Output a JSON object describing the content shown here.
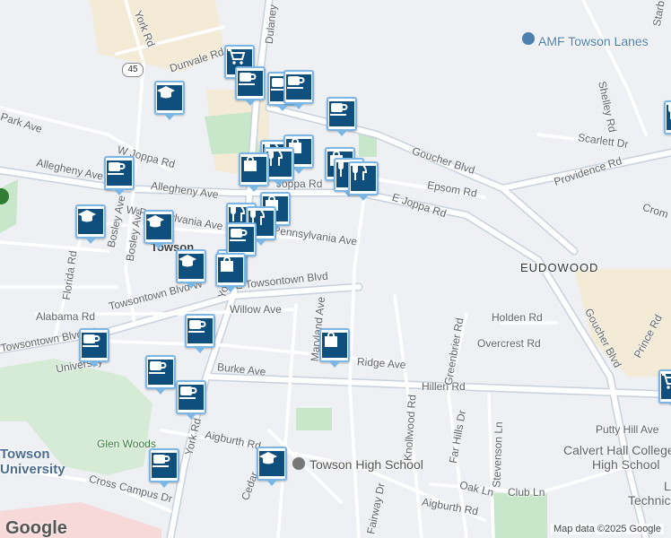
{
  "map": {
    "colors": {
      "background": "#eef0f3",
      "road": "#ffffff",
      "major_road": "#c9d1dc",
      "park": "#c8e6c9",
      "commercial": "#f3ebd6",
      "pin_border": "#7ab7e6",
      "pin_fill": "#0f4f7d"
    },
    "street_labels": [
      {
        "text": "York Rd"
      },
      {
        "text": "Bosley Ave"
      },
      {
        "text": "Dunvale Rd"
      },
      {
        "text": "Dulaney"
      },
      {
        "text": "Park Ave"
      },
      {
        "text": "W Joppa Rd"
      },
      {
        "text": "Allegheny Ave"
      },
      {
        "text": "Allegheny Ave"
      },
      {
        "text": "Joppa Rd"
      },
      {
        "text": "E Joppa Rd"
      },
      {
        "text": "W Pennsylvania Ave"
      },
      {
        "text": "Pennsylvania Ave"
      },
      {
        "text": "Florida Rd"
      },
      {
        "text": "Bosley Ave"
      },
      {
        "text": "York Rd"
      },
      {
        "text": "E Towsontown Blvd"
      },
      {
        "text": "Towsontown Blvd W"
      },
      {
        "text": "Alabama Rd"
      },
      {
        "text": "Willow Ave"
      },
      {
        "text": "Maryland Ave"
      },
      {
        "text": "Ridge Ave"
      },
      {
        "text": "Burke Ave"
      },
      {
        "text": "Hillen Rd"
      },
      {
        "text": "Towsontown Blvd W"
      },
      {
        "text": "University"
      },
      {
        "text": "Aigburth Rd"
      },
      {
        "text": "Cross Campus Dr"
      },
      {
        "text": "York Rd"
      },
      {
        "text": "Cedar"
      },
      {
        "text": "Fairway Dr"
      },
      {
        "text": "Knollwood Rd"
      },
      {
        "text": "Greenbrier Rd"
      },
      {
        "text": "Holden Rd"
      },
      {
        "text": "Overcrest Rd"
      },
      {
        "text": "Far Hills Dr"
      },
      {
        "text": "Stevenson Ln"
      },
      {
        "text": "Oak Ln"
      },
      {
        "text": "Club Ln"
      },
      {
        "text": "Aigburth Rd"
      },
      {
        "text": "Goucher Blvd"
      },
      {
        "text": "Epsom Rd"
      },
      {
        "text": "Providence Rd"
      },
      {
        "text": "Scarlett Dr"
      },
      {
        "text": "Shelley Rd"
      },
      {
        "text": "Goucher Blvd"
      },
      {
        "text": "Prince Rd"
      },
      {
        "text": "Putty Hill Ave"
      },
      {
        "text": "Crom"
      }
    ],
    "place_labels": [
      {
        "text": "Towson"
      },
      {
        "text": "EUDOWOOD"
      },
      {
        "text": "Towson"
      },
      {
        "text": "University"
      },
      {
        "text": "Glen Woods"
      },
      {
        "text": "AMF Towson Lanes"
      },
      {
        "text": "Towson High School"
      },
      {
        "text": "Calvert Hall College"
      },
      {
        "text": "High School"
      },
      {
        "text": "Technica"
      },
      {
        "text": "L"
      },
      {
        "text": "Starb"
      }
    ],
    "route_shield": "45",
    "pins": [
      {
        "icon": "cart"
      },
      {
        "icon": "cup"
      },
      {
        "icon": "cup"
      },
      {
        "icon": "cup"
      },
      {
        "icon": "grad"
      },
      {
        "icon": "cup"
      },
      {
        "icon": "cup"
      },
      {
        "icon": "utensils"
      },
      {
        "icon": "bag"
      },
      {
        "icon": "utensils"
      },
      {
        "icon": "bag"
      },
      {
        "icon": "bag"
      },
      {
        "icon": "utensils"
      },
      {
        "icon": "utensils"
      },
      {
        "icon": "bag"
      },
      {
        "icon": "utensils"
      },
      {
        "icon": "utensils"
      },
      {
        "icon": "bag"
      },
      {
        "icon": "grad"
      },
      {
        "icon": "grad"
      },
      {
        "icon": "cup"
      },
      {
        "icon": "grad"
      },
      {
        "icon": "bag"
      },
      {
        "icon": "cup"
      },
      {
        "icon": "cup"
      },
      {
        "icon": "bag"
      },
      {
        "icon": "cup"
      },
      {
        "icon": "cup"
      },
      {
        "icon": "cup"
      },
      {
        "icon": "grad"
      },
      {
        "icon": "cart"
      },
      {
        "icon": "utensils"
      }
    ],
    "logo": "Google",
    "attribution": "Map data ©2025 Google"
  }
}
